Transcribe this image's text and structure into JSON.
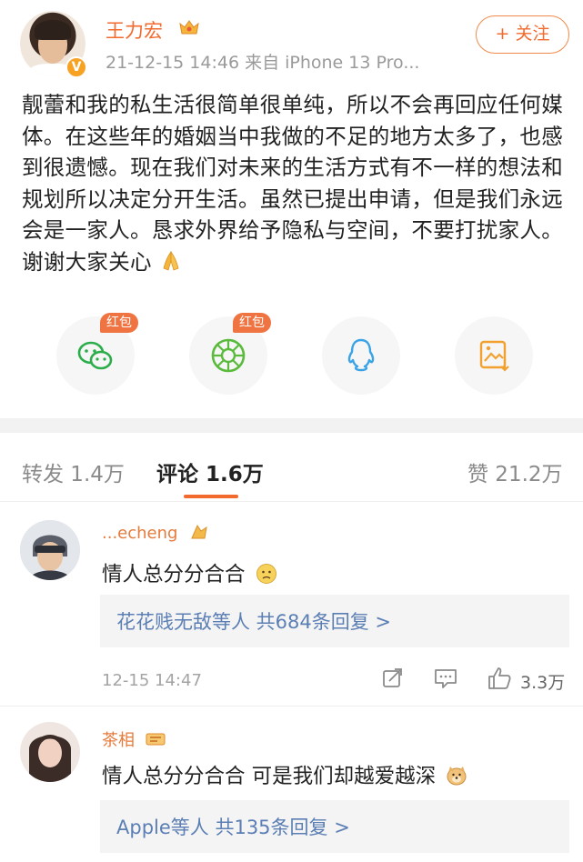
{
  "post": {
    "author": "王力宏",
    "meta": "21-12-15 14:46  来自 iPhone 13 Pro...",
    "follow_label": "+ 关注",
    "text": "靓蕾和我的私生活很简单很单纯，所以不会再回应任何媒体。在这些年的婚姻当中我做的不足的地方太多了，也感到很遗憾。现在我们对未来的生活方式有不一样的想法和规划所以决定分开生活。虽然已提出申请，但是我们永远会是一家人。恳求外界给予隐私与空间，不要打扰家人。谢谢大家关心",
    "emoji": "pray-hands-icon"
  },
  "share": {
    "items": [
      {
        "name": "wechat-share",
        "badge": "红包",
        "icon": "wechat-icon",
        "color": "#2bad4a"
      },
      {
        "name": "moments-share",
        "badge": "红包",
        "icon": "moments-icon",
        "color": "#5aba3c"
      },
      {
        "name": "qq-share",
        "badge": "",
        "icon": "qq-icon",
        "color": "#3aa3e6"
      },
      {
        "name": "save-image",
        "badge": "",
        "icon": "image-download-icon",
        "color": "#f2a12e"
      }
    ]
  },
  "tabs": {
    "repost": "转发 1.4万",
    "comments": "评论 1.6万",
    "likes": "赞 21.2万"
  },
  "comments": [
    {
      "name": "...echeng",
      "text": "情人总分分合合",
      "emoji": "slight-frown-face-icon",
      "reply": "花花贱无敌等人  共684条回复 >",
      "time": "12-15 14:47",
      "like_count": "3.3万"
    },
    {
      "name": "茶相",
      "text": "情人总分分合合 可是我们却越爱越深",
      "emoji": "doge-face-icon",
      "reply": "Apple等人  共135条回复 >"
    }
  ],
  "colors": {
    "accent": "#f26a2e",
    "link": "#5b7fb4"
  }
}
